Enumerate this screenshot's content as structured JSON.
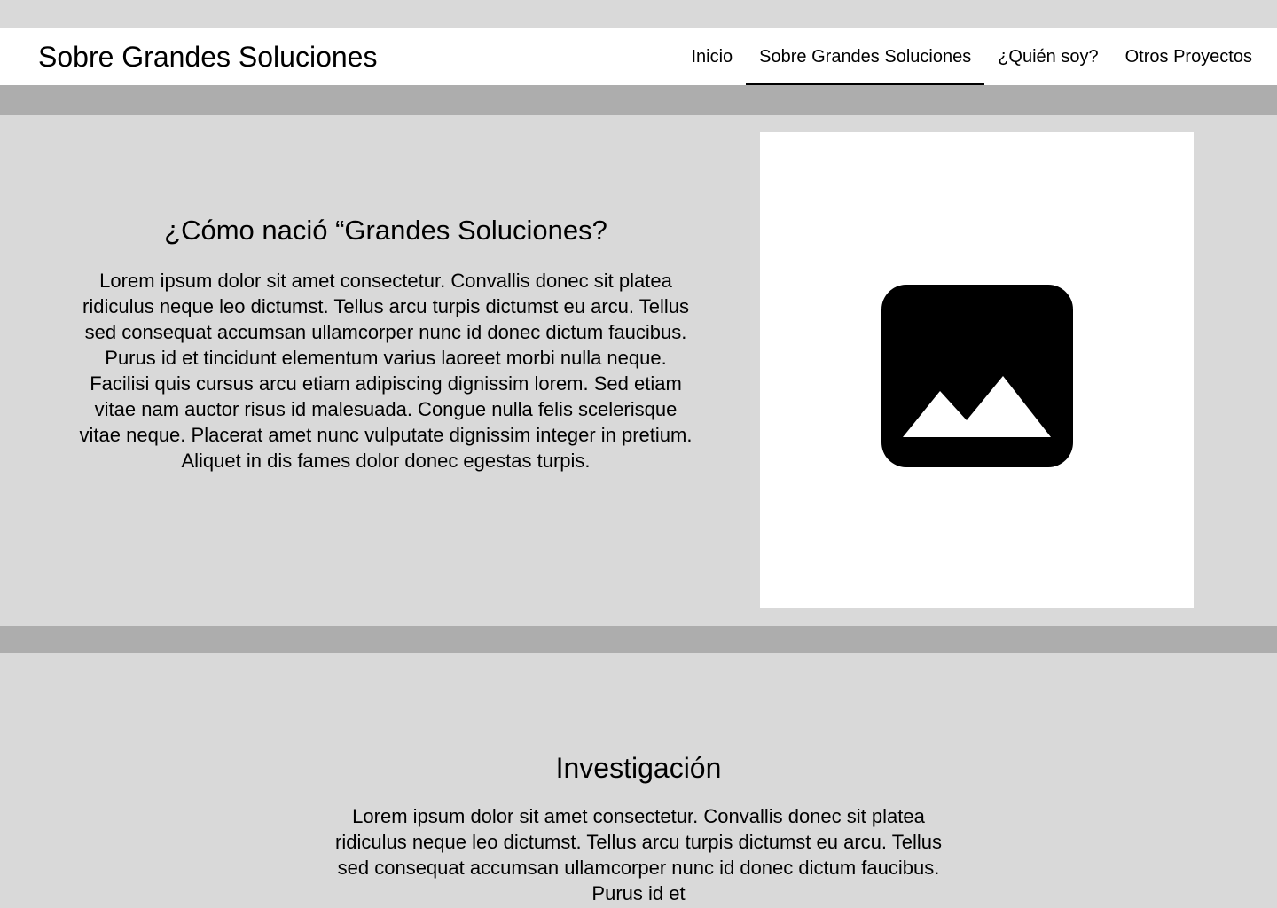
{
  "header": {
    "title": "Sobre Grandes Soluciones",
    "nav": [
      {
        "label": "Inicio",
        "active": false
      },
      {
        "label": "Sobre Grandes Soluciones",
        "active": true
      },
      {
        "label": "¿Quién soy?",
        "active": false
      },
      {
        "label": "Otros Proyectos",
        "active": false
      }
    ]
  },
  "section_origin": {
    "heading": "¿Cómo nació “Grandes Soluciones?",
    "body": "Lorem ipsum dolor sit amet consectetur. Convallis donec sit platea ridiculus neque leo dictumst. Tellus arcu turpis dictumst eu arcu. Tellus sed consequat accumsan ullamcorper nunc id donec dictum faucibus. Purus id et tincidunt elementum varius laoreet morbi nulla neque. Facilisi quis cursus arcu etiam adipiscing dignissim lorem. Sed etiam vitae nam auctor risus id malesuada. Congue nulla felis scelerisque vitae neque. Placerat amet nunc vulputate dignissim integer in pretium. Aliquet in dis fames dolor donec egestas turpis.",
    "image_icon": "image-placeholder-icon"
  },
  "section_research": {
    "heading": "Investigación",
    "body": "Lorem ipsum dolor sit amet consectetur. Convallis donec sit platea ridiculus neque leo dictumst. Tellus arcu turpis dictumst eu arcu. Tellus sed consequat accumsan ullamcorper nunc id donec dictum faucibus. Purus id et"
  },
  "colors": {
    "page_bg": "#d9d9d9",
    "band": "#adadad",
    "header_bg": "#ffffff",
    "text": "#000000"
  }
}
